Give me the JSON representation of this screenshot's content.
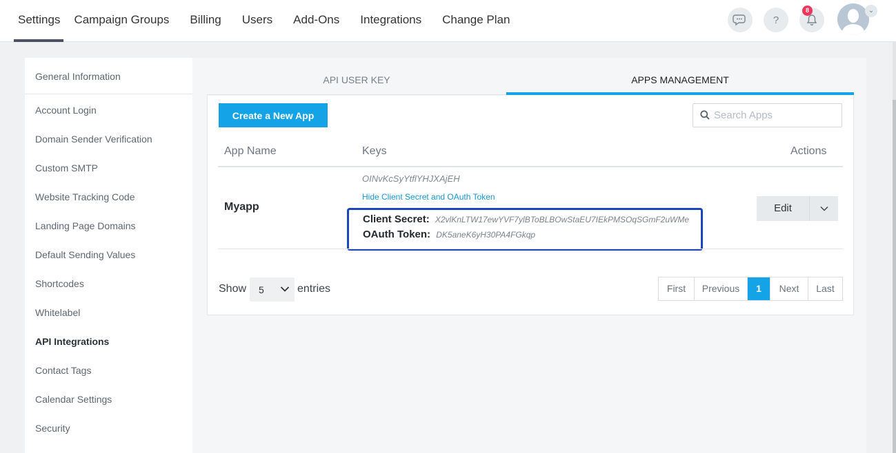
{
  "nav": {
    "items": [
      "Settings",
      "Campaign Groups",
      "Billing",
      "Users",
      "Add-Ons",
      "Integrations",
      "Change Plan"
    ],
    "active": "Settings",
    "help_label": "?",
    "notification_count": "8"
  },
  "sidebar": {
    "items": [
      "General Information",
      "Account Login",
      "Domain Sender Verification",
      "Custom SMTP",
      "Website Tracking Code",
      "Landing Page Domains",
      "Default Sending Values",
      "Shortcodes",
      "Whitelabel",
      "API Integrations",
      "Contact Tags",
      "Calendar Settings",
      "Security"
    ],
    "active": "API Integrations"
  },
  "tabs": {
    "api_user_key": "API USER KEY",
    "apps_management": "APPS MANAGEMENT",
    "active": "APPS MANAGEMENT"
  },
  "toolbar": {
    "create_label": "Create a New App",
    "search_placeholder": "Search Apps"
  },
  "table": {
    "columns": [
      "App Name",
      "Keys",
      "Actions"
    ],
    "rows": [
      {
        "app_name": "Myapp",
        "key_id": "OINvKcSyYtflYHJXAjEH",
        "hide_link": "Hide Client Secret and OAuth Token",
        "client_secret_label": "Client Secret:",
        "client_secret": "X2vlKnLTW17ewYVF7ylBToBLBOwStaEU7IEkPMSOqSGmF2uWMe",
        "oauth_token_label": "OAuth Token:",
        "oauth_token": "DK5aneK6yH30PA4FGkqp",
        "action_label": "Edit"
      }
    ]
  },
  "footer": {
    "show_label": "Show",
    "entries_value": "5",
    "entries_label": "entries",
    "pagination": [
      "First",
      "Previous",
      "1",
      "Next",
      "Last"
    ],
    "current_page": "1"
  },
  "colors": {
    "accent": "#13a3e6",
    "highlight_box": "#1b45b8",
    "badge": "#f0345c"
  }
}
